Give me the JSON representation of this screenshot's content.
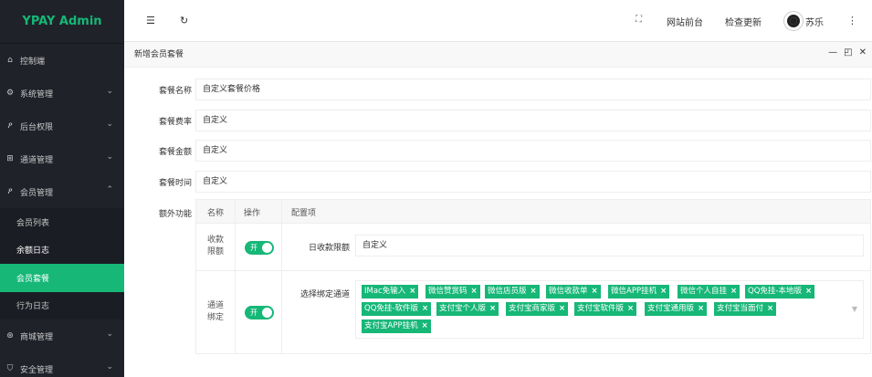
{
  "app": {
    "title": "YPAY Admin"
  },
  "sidebar": {
    "items": [
      {
        "label": "控制端",
        "icon": "home-icon"
      },
      {
        "label": "系统管理",
        "icon": "gear-icon",
        "arrow": "⌄"
      },
      {
        "label": "后台权限",
        "icon": "user-icon",
        "arrow": "⌄"
      },
      {
        "label": "通道管理",
        "icon": "channel-icon",
        "arrow": "⌄"
      },
      {
        "label": "会员管理",
        "icon": "user-icon",
        "arrow": "⌃"
      }
    ],
    "sub_items": [
      {
        "label": "会员列表"
      },
      {
        "label": "余额日志"
      },
      {
        "label": "会员套餐"
      },
      {
        "label": "行为日志"
      }
    ],
    "bottom_items": [
      {
        "label": "商城管理",
        "icon": "shop-icon",
        "arrow": "⌄"
      },
      {
        "label": "安全管理",
        "icon": "shield-icon",
        "arrow": "⌄"
      }
    ]
  },
  "header": {
    "site_front": "网站前台",
    "check_update": "检查更新",
    "username": "苏乐"
  },
  "panel": {
    "title": "新增会员套餐",
    "fields": [
      {
        "label": "套餐名称",
        "value": "自定义套餐价格"
      },
      {
        "label": "套餐费率",
        "value": "自定义"
      },
      {
        "label": "套餐金额",
        "value": "自定义"
      },
      {
        "label": "套餐时间",
        "value": "自定义"
      }
    ],
    "extra": {
      "label": "额外功能",
      "headers": [
        "名称",
        "操作",
        "配置项"
      ],
      "row1": {
        "name_line1": "收款",
        "name_line2": "限额",
        "switch": "开",
        "config_label": "日收款限额",
        "config_value": "自定义"
      },
      "row2": {
        "name_line1": "通道",
        "name_line2": "绑定",
        "switch": "开",
        "config_label": "选择绑定通道",
        "tags": [
          "IMac免输入",
          "微信赞赏码",
          "微信店员版",
          "微信收款单",
          "微信APP挂机",
          "微信个人自挂",
          "QQ免挂-本地版",
          "QQ免挂-软件版",
          "支付宝个人版",
          "支付宝商家版",
          "支付宝软件版",
          "支付宝通用版",
          "支付宝当面付",
          "支付宝APP挂机"
        ]
      }
    }
  }
}
